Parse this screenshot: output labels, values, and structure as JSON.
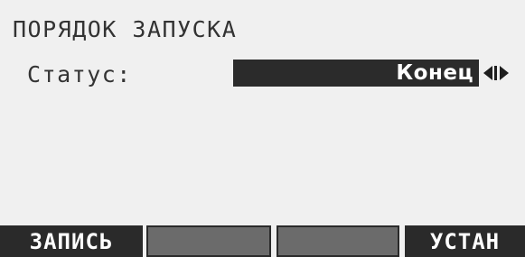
{
  "screen": {
    "title": "ПОРЯДОК ЗАПУСКА",
    "status_label": "Статус:",
    "status_value": "Конец",
    "status_arrows_icon": "left-right-arrows-icon"
  },
  "softkeys": [
    {
      "label": "ЗАПИСЬ"
    },
    {
      "label": ""
    },
    {
      "label": ""
    },
    {
      "label": "УСТАН"
    }
  ],
  "colors": {
    "background": "#f0f0f0",
    "field_bg": "#2b2b2b",
    "softkey_bg": "#2a2a2a",
    "softkey_empty_bg": "#6b6b6b",
    "text": "#333333"
  }
}
